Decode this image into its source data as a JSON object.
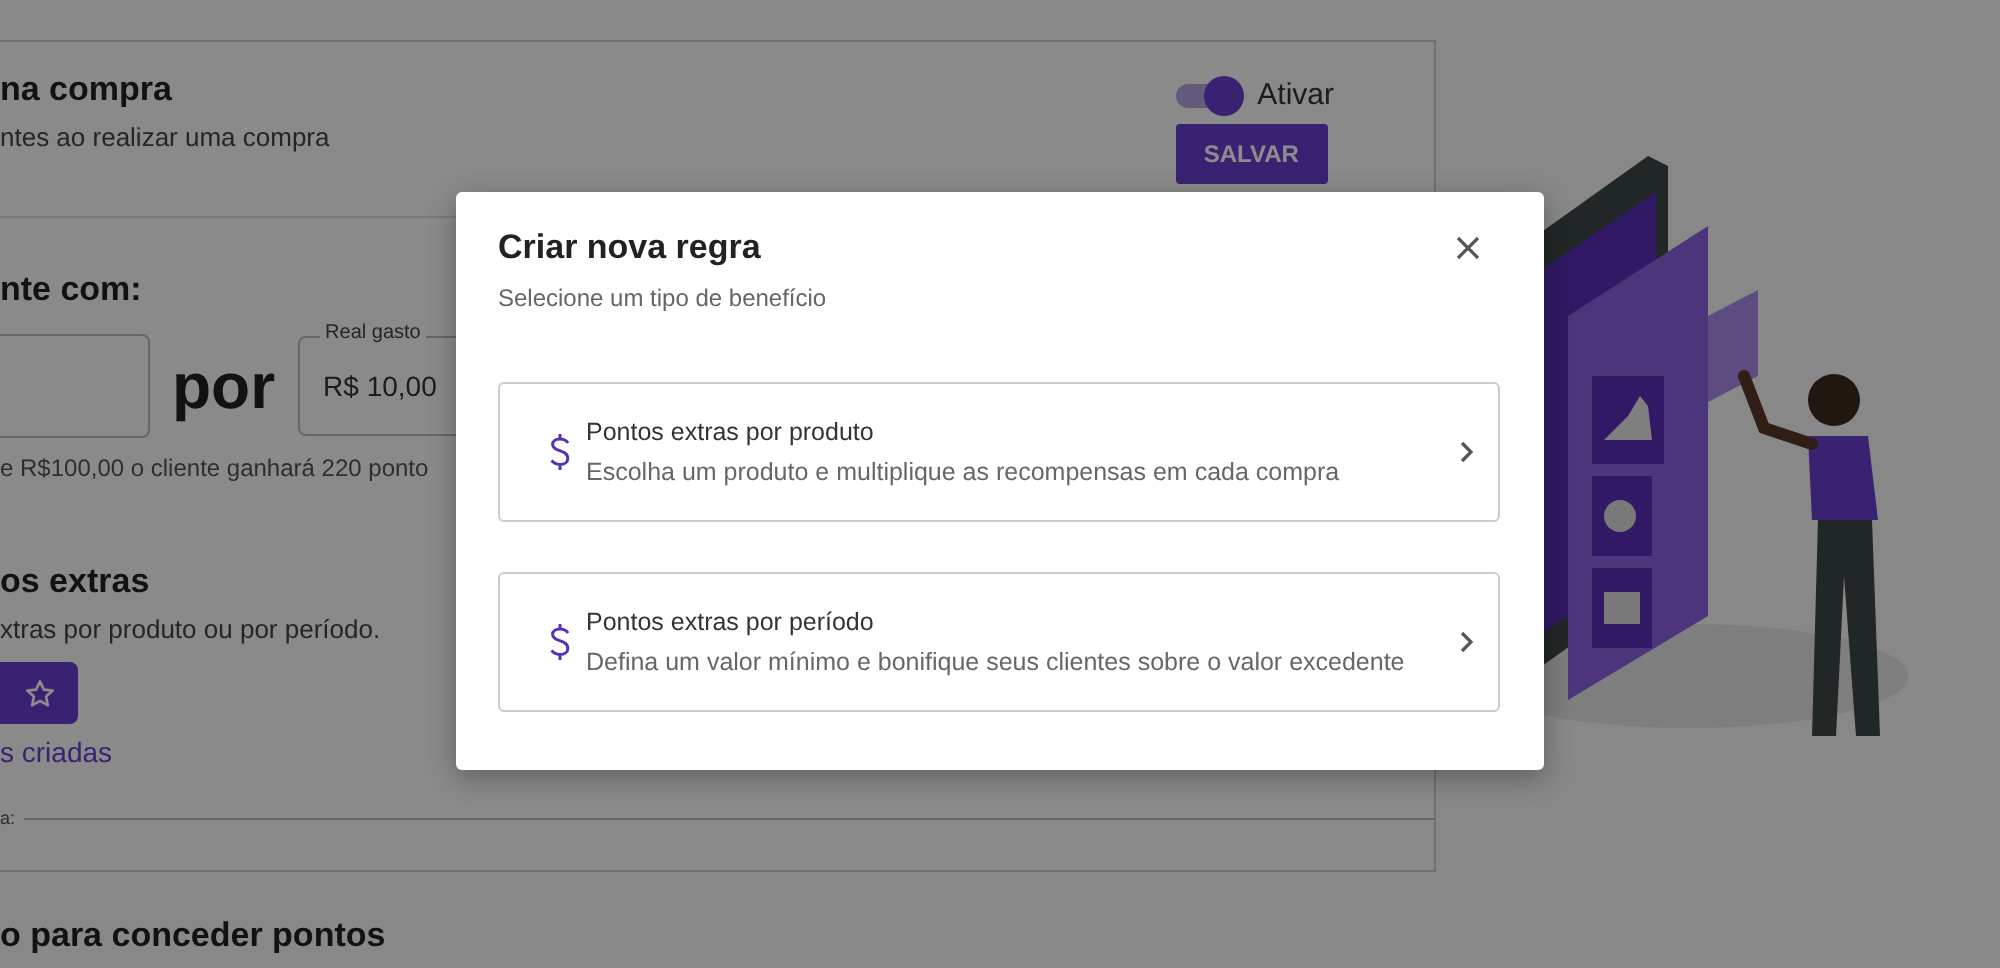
{
  "background": {
    "purchase_section": {
      "title": "na compra",
      "subtitle": "ntes ao realizar uma compra",
      "toggle": {
        "label": "Ativar",
        "on": true
      },
      "save_button": "SALVAR"
    },
    "earn_section": {
      "title": "nte com:",
      "connector": "por",
      "spend_field": {
        "label": "Real gasto",
        "value": "R$ 10,00"
      },
      "hint": "e R$100,00 o cliente ganhará 220 ponto"
    },
    "extras_section": {
      "title": "os extras",
      "subtitle": "xtras por produto ou por período.",
      "link": "s criadas",
      "field_label": "a:"
    },
    "next_section": {
      "title": "o para conceder pontos"
    }
  },
  "modal": {
    "title": "Criar nova regra",
    "subtitle": "Selecione um tipo de benefício",
    "options": [
      {
        "title": "Pontos extras por produto",
        "description": "Escolha um produto e multiplique as recompensas em cada compra"
      },
      {
        "title": "Pontos extras por período",
        "description": "Defina um valor mínimo e bonifique seus clientes sobre o valor excedente"
      }
    ]
  }
}
